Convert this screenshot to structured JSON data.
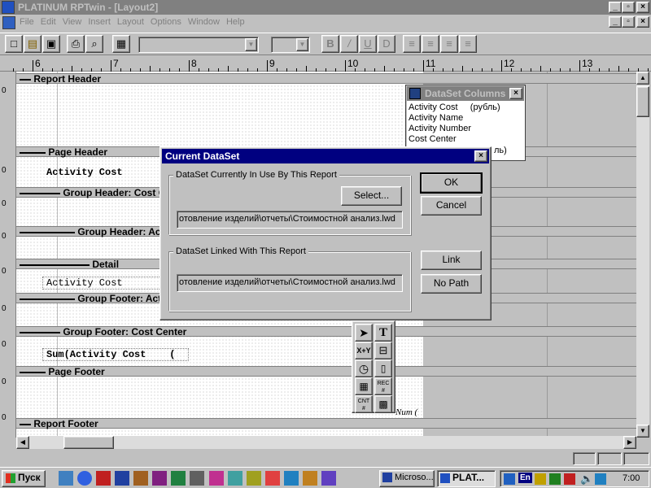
{
  "app": {
    "title": "PLATINUM RPTwin - [Layout2]"
  },
  "menu": [
    "File",
    "Edit",
    "View",
    "Insert",
    "Layout",
    "Options",
    "Window",
    "Help"
  ],
  "ruler": {
    "labels": [
      "6",
      "7",
      "8",
      "9",
      "10",
      "11",
      "12",
      "13"
    ]
  },
  "bands": {
    "report_header": "Report Header",
    "page_header": "Page Header",
    "group_header_cost": "Group Header: Cost C",
    "group_header_act": "Group Header: Ac",
    "detail": "Detail",
    "group_footer_act": "Group Footer: Act",
    "group_footer_cost": "Group Footer: Cost Center",
    "page_footer": "Page Footer",
    "report_footer": "Report Footer"
  },
  "fields": {
    "page_header_field": "Activity Cost",
    "detail_field": "Activity Cost",
    "footer_field": "Sum(Activity Cost    (",
    "page_num_field": "Num ("
  },
  "left_margin_mark": "0",
  "dataset_columns": {
    "title": "DataSet Columns",
    "items": [
      "Activity Cost     (рубль)",
      "Activity Name",
      "Activity Number",
      "Cost Center"
    ],
    "partial_tail": "ль)"
  },
  "dialog": {
    "title": "Current DataSet",
    "group1_label": "DataSet Currently In Use By This Report",
    "select_button": "Select...",
    "path1": "отовление изделий\\отчеты\\Стоимостной анализ.lwd",
    "group2_label": "DataSet Linked With This Report",
    "path2": "отовление изделий\\отчеты\\Стоимостной анализ.lwd",
    "ok": "OK",
    "cancel": "Cancel",
    "link": "Link",
    "no_path": "No Path"
  },
  "toolbox": {
    "tools": [
      "arrow",
      "T",
      "X+Y",
      "",
      "",
      "",
      "",
      "REC #",
      "CNT #",
      ""
    ]
  },
  "taskbar": {
    "start": "Пуск",
    "tasks": [
      "Microso...",
      "PLAT..."
    ],
    "lang": "En",
    "clock": "7:00"
  }
}
